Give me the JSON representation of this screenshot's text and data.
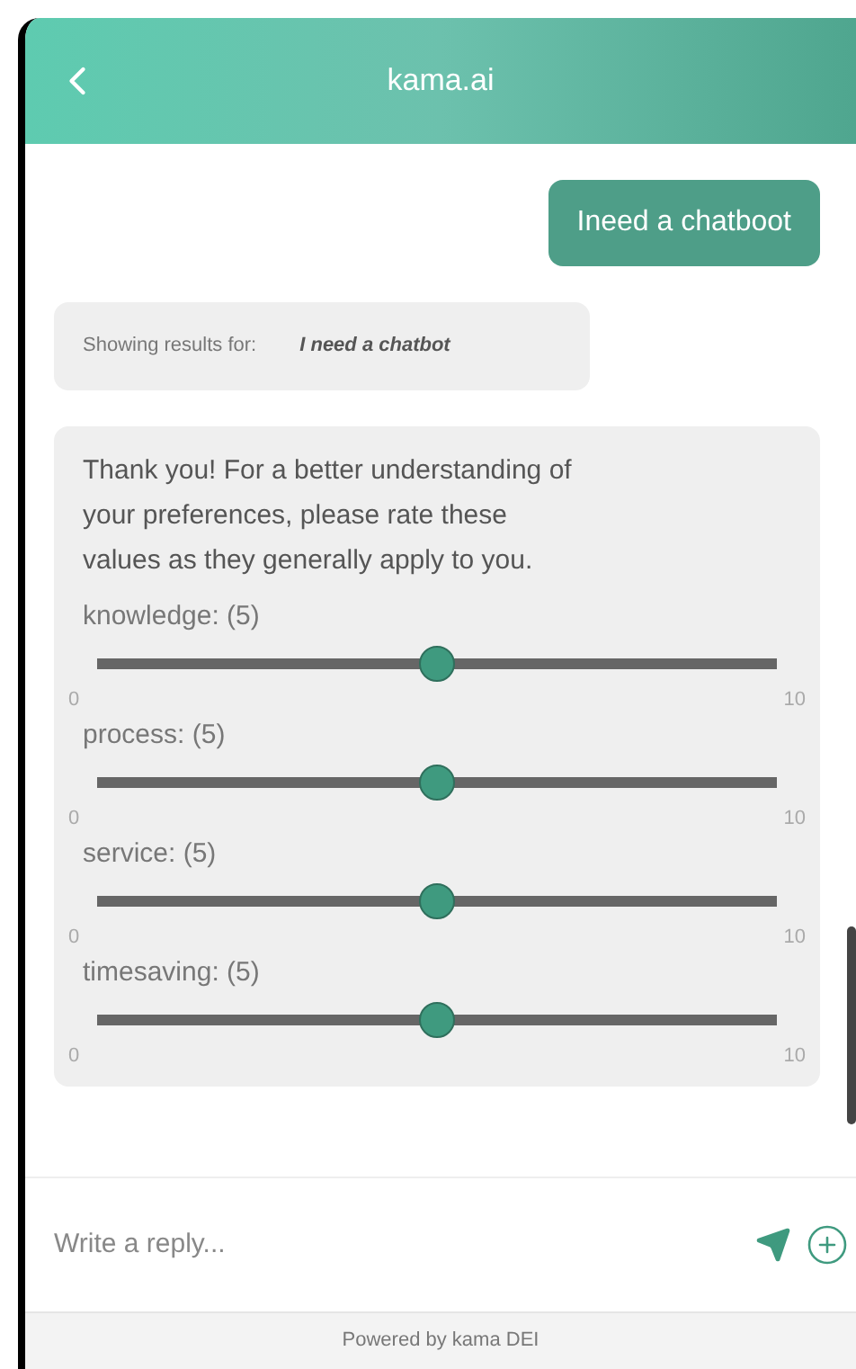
{
  "header": {
    "title": "kama.ai"
  },
  "messages": [
    {
      "kind": "user",
      "text": "Ineed a chatboot"
    },
    {
      "kind": "results",
      "label": "Showing results for:",
      "query": "I need a chatbot"
    }
  ],
  "card": {
    "intro": "Thank you! For a better understanding of your preferences, please rate these values as they generally apply to you.",
    "sliders": [
      {
        "label": "knowledge: (5)",
        "level": 0.5,
        "min": "0",
        "max": "10"
      },
      {
        "label": "process: (5)",
        "level": 0.5,
        "min": "0",
        "max": "10"
      },
      {
        "label": "service: (5)",
        "level": 0.5,
        "min": "0",
        "max": "10"
      },
      {
        "label": "timesaving: (5)",
        "level": 0.5,
        "min": "0",
        "max": "10"
      }
    ]
  },
  "composer": {
    "placeholder": "Write a reply..."
  },
  "footer": "Powered by kama DEI"
}
